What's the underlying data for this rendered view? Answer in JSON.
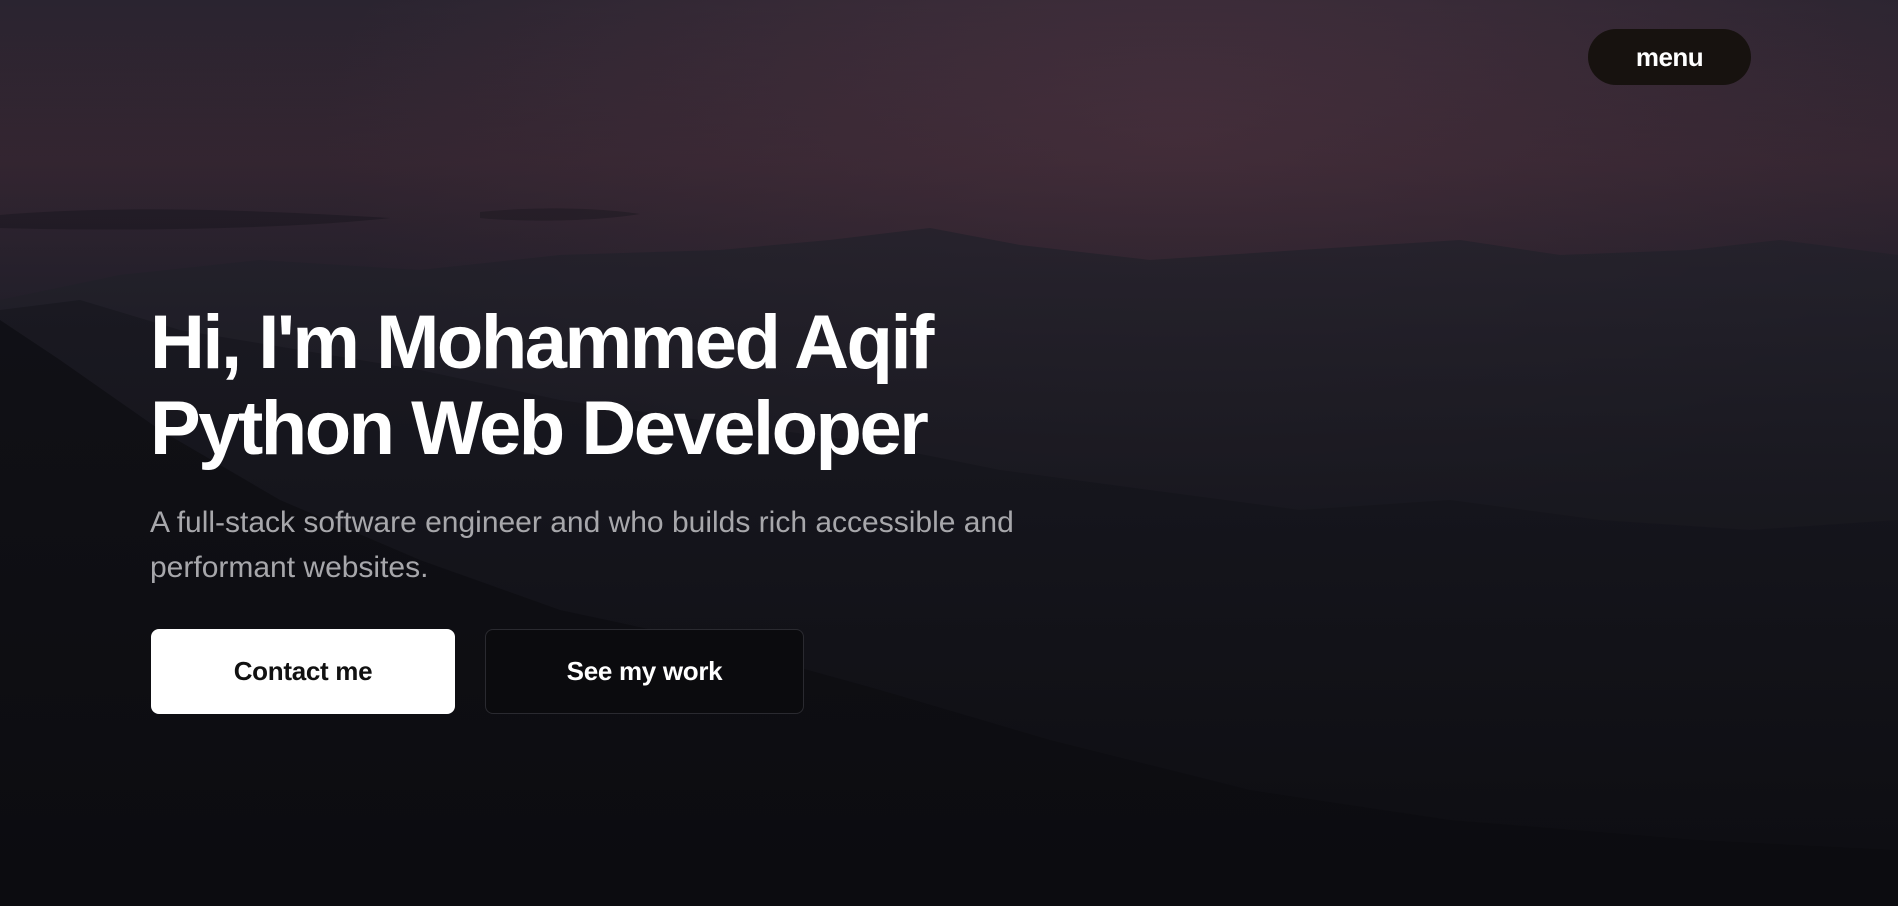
{
  "nav": {
    "menu_label": "menu"
  },
  "hero": {
    "headline_line1": "Hi, I'm Mohammed Aqif",
    "headline_line2": "Python Web Developer",
    "subtitle": "A full-stack software engineer and who builds rich accessible and performant websites.",
    "primary_cta": "Contact me",
    "secondary_cta": "See my work"
  },
  "colors": {
    "background_top": "#3a2a36",
    "background_bottom": "#0c0c10",
    "menu_button": "#17120f",
    "primary_button": "#ffffff",
    "subtitle_text": "#a7a7ab"
  }
}
